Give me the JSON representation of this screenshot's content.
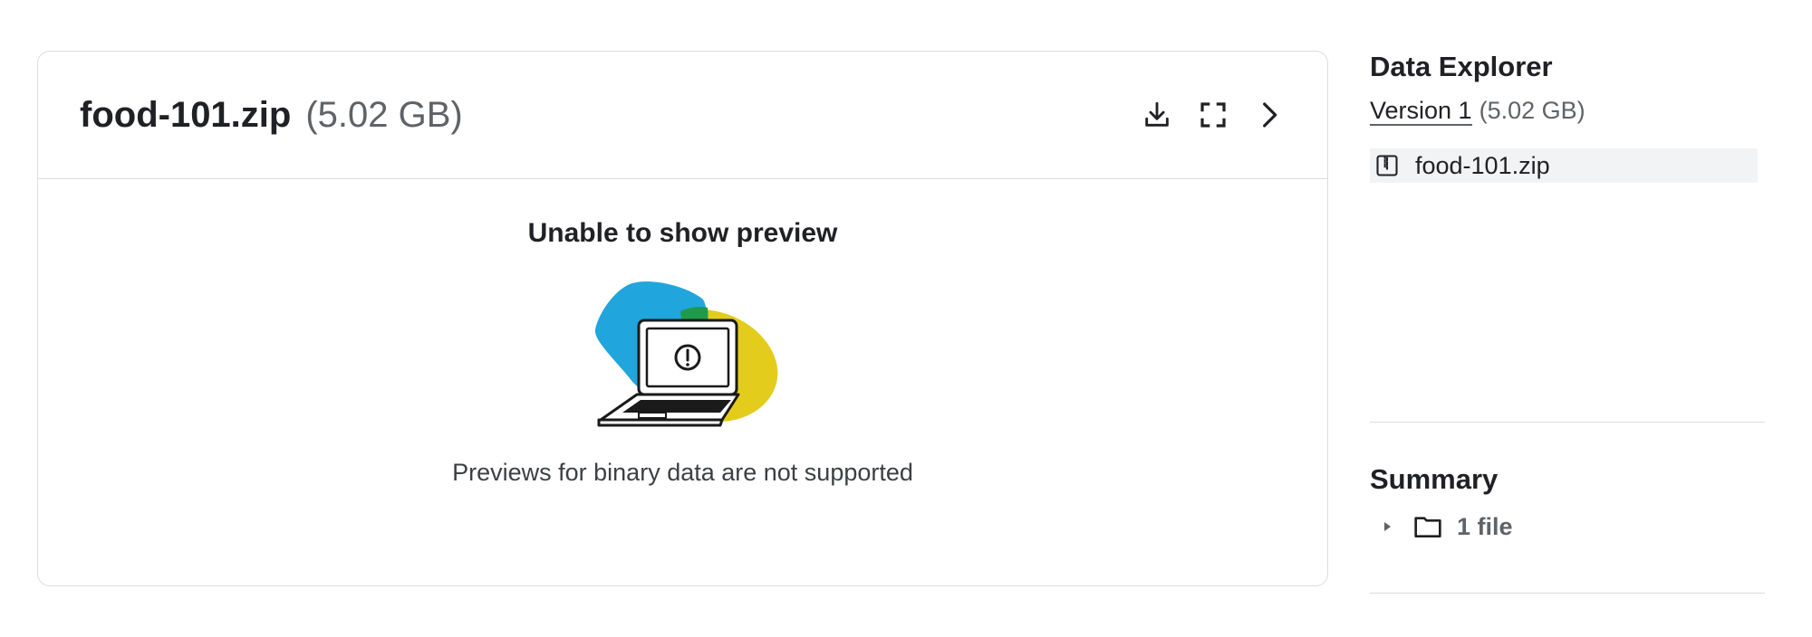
{
  "preview": {
    "file_name": "food-101.zip",
    "file_size": "(5.02 GB)",
    "heading": "Unable to show preview",
    "message": "Previews for binary data are not supported",
    "actions": [
      {
        "icon": "download-icon"
      },
      {
        "icon": "fullscreen-icon"
      },
      {
        "icon": "chevron-right-icon"
      }
    ]
  },
  "explorer": {
    "title": "Data Explorer",
    "version_label": "Version 1",
    "version_size": "(5.02 GB)",
    "files": [
      {
        "name": "food-101.zip",
        "icon": "zip-file-icon"
      }
    ]
  },
  "summary": {
    "title": "Summary",
    "file_count": "1 file",
    "icon": "folder-icon"
  },
  "colors": {
    "illustration_blue": "#20a6dc",
    "illustration_yellow": "#e3cc1c",
    "illustration_green": "#1f9a4b",
    "border": "#dadce0",
    "muted_text": "#5f6368"
  }
}
